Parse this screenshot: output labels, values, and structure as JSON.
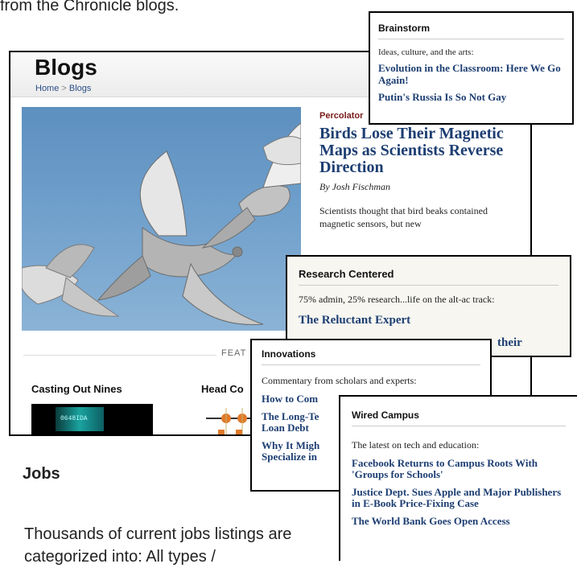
{
  "intro_text": "from the Chronicle blogs.",
  "main": {
    "title": "Blogs",
    "breadcrumb": {
      "home": "Home",
      "sep": ">",
      "current": "Blogs"
    },
    "feature": {
      "category": "Percolator",
      "headline": "Birds Lose Their Magnetic Maps as Scientists Reverse Direction",
      "byline": "By Josh Fischman",
      "summary": "Scientists thought that bird beaks contained magnetic sensors, but new"
    },
    "featured_label": "FEAT",
    "columns": [
      {
        "title": "Casting Out Nines"
      },
      {
        "title": "Head Co"
      }
    ],
    "thumb_text": "0648IDA"
  },
  "brainstorm": {
    "title": "Brainstorm",
    "intro": "Ideas, culture, and the arts:",
    "links": [
      "Evolution in the Classroom: Here We Go Again!",
      "Putin's Russia Is So Not Gay"
    ]
  },
  "research": {
    "title": "Research Centered",
    "intro": "75% admin, 25% research...life on the alt-ac track:",
    "links": [
      "The Reluctant Expert"
    ],
    "tail": "their"
  },
  "innovations": {
    "title": "Innovations",
    "intro": "Commentary from scholars and experts:",
    "links": [
      "How to Com",
      "The Long-Te\nLoan Debt",
      "Why It Migh\nSpecialize in"
    ]
  },
  "wired": {
    "title": "Wired Campus",
    "intro": "The latest on tech and education:",
    "links": [
      "Facebook Returns to Campus Roots With 'Groups for Schools'",
      "Justice Dept. Sues Apple and Major Publishers in E-Book Price-Fixing Case",
      "The World Bank Goes Open Access"
    ]
  },
  "jobs_heading": "Jobs",
  "jobs_text": "Thousands of current jobs listings are categorized into: All types /"
}
